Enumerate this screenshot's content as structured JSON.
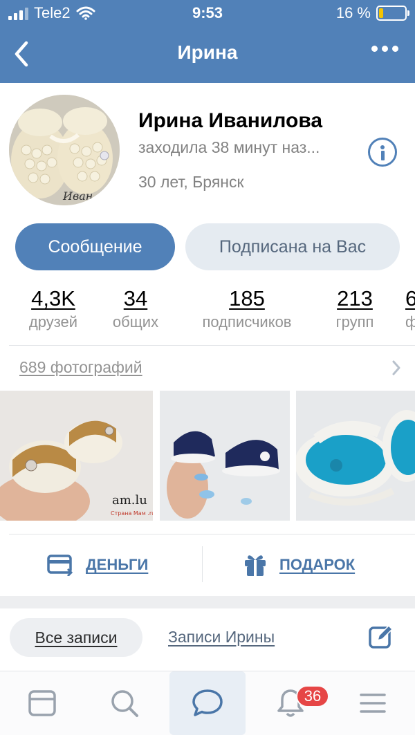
{
  "status_bar": {
    "carrier": "Tele2",
    "time": "9:53",
    "battery_text": "16 %",
    "battery_level": 0.16
  },
  "nav": {
    "title": "Ирина",
    "back_icon": "chevron-left-icon",
    "more_icon": "more-horizontal-icon"
  },
  "profile": {
    "name": "Ирина Иванилова",
    "last_seen": "заходила 38 минут наз...",
    "age_city": "30 лет, Брянск",
    "avatar_caption": "Иван"
  },
  "buttons": {
    "message": "Сообщение",
    "subscribed": "Подписана на Вас"
  },
  "counters": [
    {
      "value": "4,3K",
      "label": "друзей"
    },
    {
      "value": "34",
      "label": "общих"
    },
    {
      "value": "185",
      "label": "подписчиков"
    },
    {
      "value": "213",
      "label": "групп"
    },
    {
      "value": "6",
      "label": "ф"
    }
  ],
  "photos": {
    "link": "689 фотографий",
    "watermark_1": "am.lu",
    "watermark_1_sub": "Страна Мам .ru"
  },
  "actions": {
    "money": "ДЕНЬГИ",
    "gift": "ПОДАРОК"
  },
  "wall_tabs": {
    "all": "Все записи",
    "own": "Записи Ирины"
  },
  "tabbar": {
    "items": [
      "newsfeed-icon",
      "search-icon",
      "messages-icon",
      "notifications-icon",
      "menu-icon"
    ],
    "notifications_badge": "36"
  },
  "colors": {
    "accent": "#5181b8",
    "link": "#4a76a8",
    "badge": "#e64646"
  }
}
